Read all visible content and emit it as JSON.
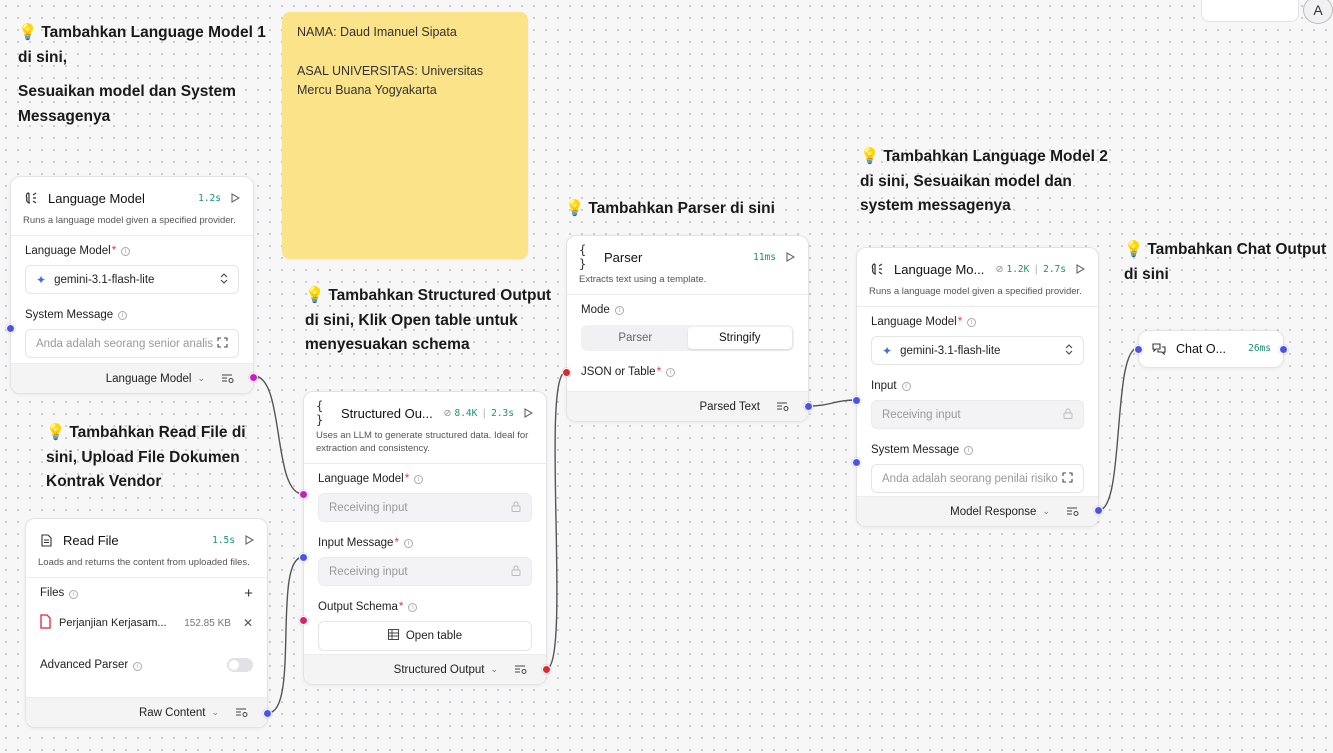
{
  "notes": {
    "lm1": {
      "line1": "Tambahkan Language Model 1",
      "line2": "di sini,",
      "line3": "Sesuaikan model dan System",
      "line4": "Messagenya"
    },
    "readfile": {
      "line1": "Tambahkan Read File di",
      "line2": "sini, Upload File Dokumen",
      "line3": "Kontrak Vendor"
    },
    "structured": {
      "pre": "Tambahkan ",
      "bold": "Structured Output",
      "line2a": "di sini, Klik ",
      "line2b": "Open table",
      "line2c": " untuk",
      "line3": "menyesuakan schema"
    },
    "parser": {
      "line1": "Tambahkan Parser di sini"
    },
    "lm2": {
      "line1": "Tambahkan Language Model 2",
      "line2": "di sini, Sesuaikan model dan",
      "line3": "system messagenya"
    },
    "chat": {
      "line1": "Tambahkan Chat Output",
      "line2": "di sini"
    }
  },
  "sticky": {
    "name": "NAMA: Daud Imanuel Sipata",
    "univ": "ASAL UNIVERSITAS: Universitas Mercu Buana Yogyakarta"
  },
  "lm1_node": {
    "title": "Language Model",
    "time": "1.2s",
    "desc": "Runs a language model given a specified provider.",
    "model_label": "Language Model",
    "model_value": "gemini-3.1-flash-lite",
    "sys_label": "System Message",
    "sys_value": "Anda adalah seorang senior analis",
    "output": "Language Model"
  },
  "readfile_node": {
    "title": "Read File",
    "time": "1.5s",
    "desc": "Loads and returns the content from uploaded files.",
    "files_label": "Files",
    "file_name": "Perjanjian Kerjasam...",
    "file_size": "152.85 KB",
    "adv_label": "Advanced Parser",
    "output": "Raw Content"
  },
  "structured_node": {
    "title": "Structured Ou...",
    "tokens": "8.4K",
    "time": "2.3s",
    "desc": "Uses an LLM to generate structured data. Ideal for extraction and consistency.",
    "lm_label": "Language Model",
    "lm_value": "Receiving input",
    "input_label": "Input Message",
    "input_value": "Receiving input",
    "schema_label": "Output Schema",
    "schema_button": "Open table",
    "output": "Structured Output"
  },
  "parser_node": {
    "title": "Parser",
    "time": "11ms",
    "desc": "Extracts text using a template.",
    "mode_label": "Mode",
    "mode_opt1": "Parser",
    "mode_opt2": "Stringify",
    "json_label": "JSON or Table",
    "output": "Parsed Text"
  },
  "lm2_node": {
    "title": "Language Mo...",
    "tokens": "1.2K",
    "time": "2.7s",
    "desc": "Runs a language model given a specified provider.",
    "model_label": "Language Model",
    "model_value": "gemini-3.1-flash-lite",
    "input_label": "Input",
    "input_value": "Receiving input",
    "sys_label": "System Message",
    "sys_value": "Anda adalah seorang penilai risiko",
    "output": "Model Response"
  },
  "chat_node": {
    "title": "Chat O...",
    "time": "26ms"
  },
  "colors": {
    "handle_blue": "#4c54e8",
    "handle_magenta": "#c81ec8",
    "handle_red": "#e0262f",
    "sticky": "#fbe38a",
    "stat_green": "#1d8f72"
  }
}
